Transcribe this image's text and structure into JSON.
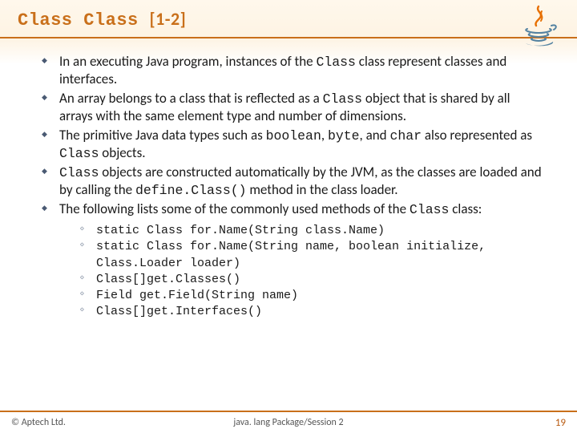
{
  "header": {
    "title_a": "Class",
    "title_b": "Class",
    "range": "[1-2]"
  },
  "logo_name": "java-logo",
  "bullets": {
    "b1a": "In an executing Java program, instances of the ",
    "b1code": "Class",
    "b1b": " class represent classes and interfaces.",
    "b2a": "An array belongs to a class that is reflected as a ",
    "b2code": "Class",
    "b2b": " object that is shared by all arrays with the same element type and number of dimensions.",
    "b3a": "The primitive Java data types such as ",
    "b3c1": "boolean",
    "b3m1": ", ",
    "b3c2": "byte",
    "b3m2": ", and ",
    "b3c3": "char",
    "b3b": " also represented as ",
    "b3c4": "Class",
    "b3end": " objects.",
    "b4a": "",
    "b4c1": "Class",
    "b4m1": " objects are constructed automatically by the JVM, as the classes are loaded and by calling the ",
    "b4c2": "define.Class()",
    "b4end": "  method in the class loader.",
    "b5a": "The following lists some of the commonly used methods of the ",
    "b5c1": "Class",
    "b5end": " class:"
  },
  "methods": {
    "m1": "static Class for.Name(String class.Name)",
    "m2": "static Class for.Name(String name, boolean initialize, Class.Loader loader)",
    "m3": "Class[]get.Classes()",
    "m4": "Field get.Field(String name)",
    "m5": "Class[]get.Interfaces()"
  },
  "footer": {
    "copyright": "© Aptech Ltd.",
    "session": "java. lang Package/Session 2",
    "page": "19"
  }
}
